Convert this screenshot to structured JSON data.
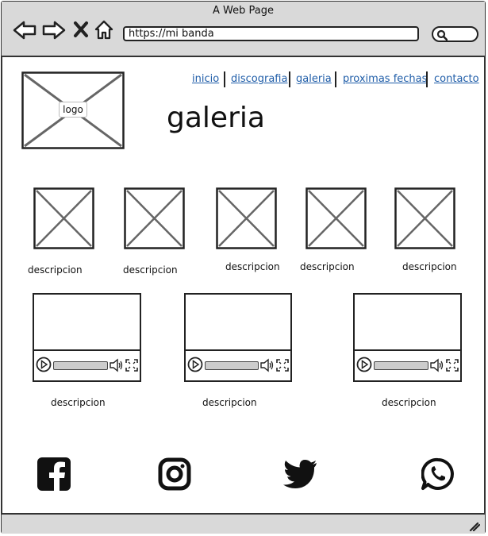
{
  "window": {
    "title": "A Web Page"
  },
  "browser": {
    "url": "https://mi banda"
  },
  "nav": {
    "links": [
      "inicio",
      "discografia",
      "galeria",
      "proximas fechas",
      "contacto"
    ]
  },
  "logo": {
    "label": "logo"
  },
  "page": {
    "heading": "galeria"
  },
  "gallery": {
    "images": [
      {
        "caption": "descripcion"
      },
      {
        "caption": "descripcion"
      },
      {
        "caption": "descripcion"
      },
      {
        "caption": "descripcion"
      },
      {
        "caption": "descripcion"
      }
    ],
    "videos": [
      {
        "caption": "descripcion"
      },
      {
        "caption": "descripcion"
      },
      {
        "caption": "descripcion"
      }
    ]
  },
  "social": {
    "icons": [
      "facebook-icon",
      "instagram-icon",
      "twitter-icon",
      "whatsapp-icon"
    ]
  }
}
